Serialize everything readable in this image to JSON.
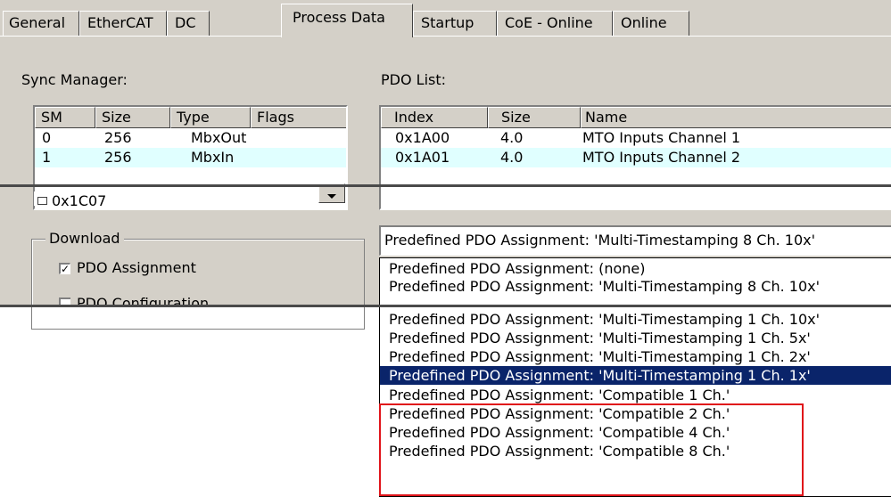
{
  "tabs": [
    {
      "label": "General"
    },
    {
      "label": "EtherCAT"
    },
    {
      "label": "DC"
    },
    {
      "label": "Process Data",
      "active": true
    },
    {
      "label": "Startup"
    },
    {
      "label": "CoE - Online"
    },
    {
      "label": "Online"
    }
  ],
  "sync_manager": {
    "title": "Sync Manager:",
    "columns": [
      "SM",
      "Size",
      "Type",
      "Flags"
    ],
    "rows": [
      {
        "sm": "0",
        "size": "256",
        "type": "MbxOut",
        "flags": ""
      },
      {
        "sm": "1",
        "size": "256",
        "type": "MbxIn",
        "flags": ""
      }
    ],
    "partial_row": "0x1C07"
  },
  "pdo_list": {
    "title": "PDO List:",
    "columns": [
      "Index",
      "Size",
      "Name"
    ],
    "rows": [
      {
        "index": "0x1A00",
        "size": "4.0",
        "name": "MTO Inputs Channel 1"
      },
      {
        "index": "0x1A01",
        "size": "4.0",
        "name": "MTO Inputs Channel 2"
      }
    ]
  },
  "download": {
    "title": "Download",
    "pdo_assignment": {
      "label": "PDO Assignment",
      "checked": true
    },
    "pdo_configuration": {
      "label": "PDO Configuration",
      "checked": false
    }
  },
  "assignment_combo": {
    "value": "Predefined PDO Assignment: 'Multi-Timestamping 8 Ch. 10x'"
  },
  "assignment_options": [
    "Predefined PDO Assignment: (none)",
    "Predefined PDO Assignment: 'Multi-Timestamping 8 Ch. 10x'",
    "Predefined PDO Assignment: 'Multi-Timestamping 1 Ch. 10x'",
    "Predefined PDO Assignment: 'Multi-Timestamping 1 Ch. 5x'",
    "Predefined PDO Assignment: 'Multi-Timestamping 1 Ch. 2x'",
    "Predefined PDO Assignment: 'Multi-Timestamping 1 Ch. 1x'",
    "Predefined PDO Assignment: 'Compatible 1 Ch.'",
    "Predefined PDO Assignment: 'Compatible 2 Ch.'",
    "Predefined PDO Assignment: 'Compatible 4 Ch.'",
    "Predefined PDO Assignment: 'Compatible 8 Ch.'"
  ],
  "highlighted_option_index": 5,
  "colors": {
    "selection": "#0a246a",
    "row_highlight": "#e0ffff",
    "annotation_box": "#e0141a"
  }
}
